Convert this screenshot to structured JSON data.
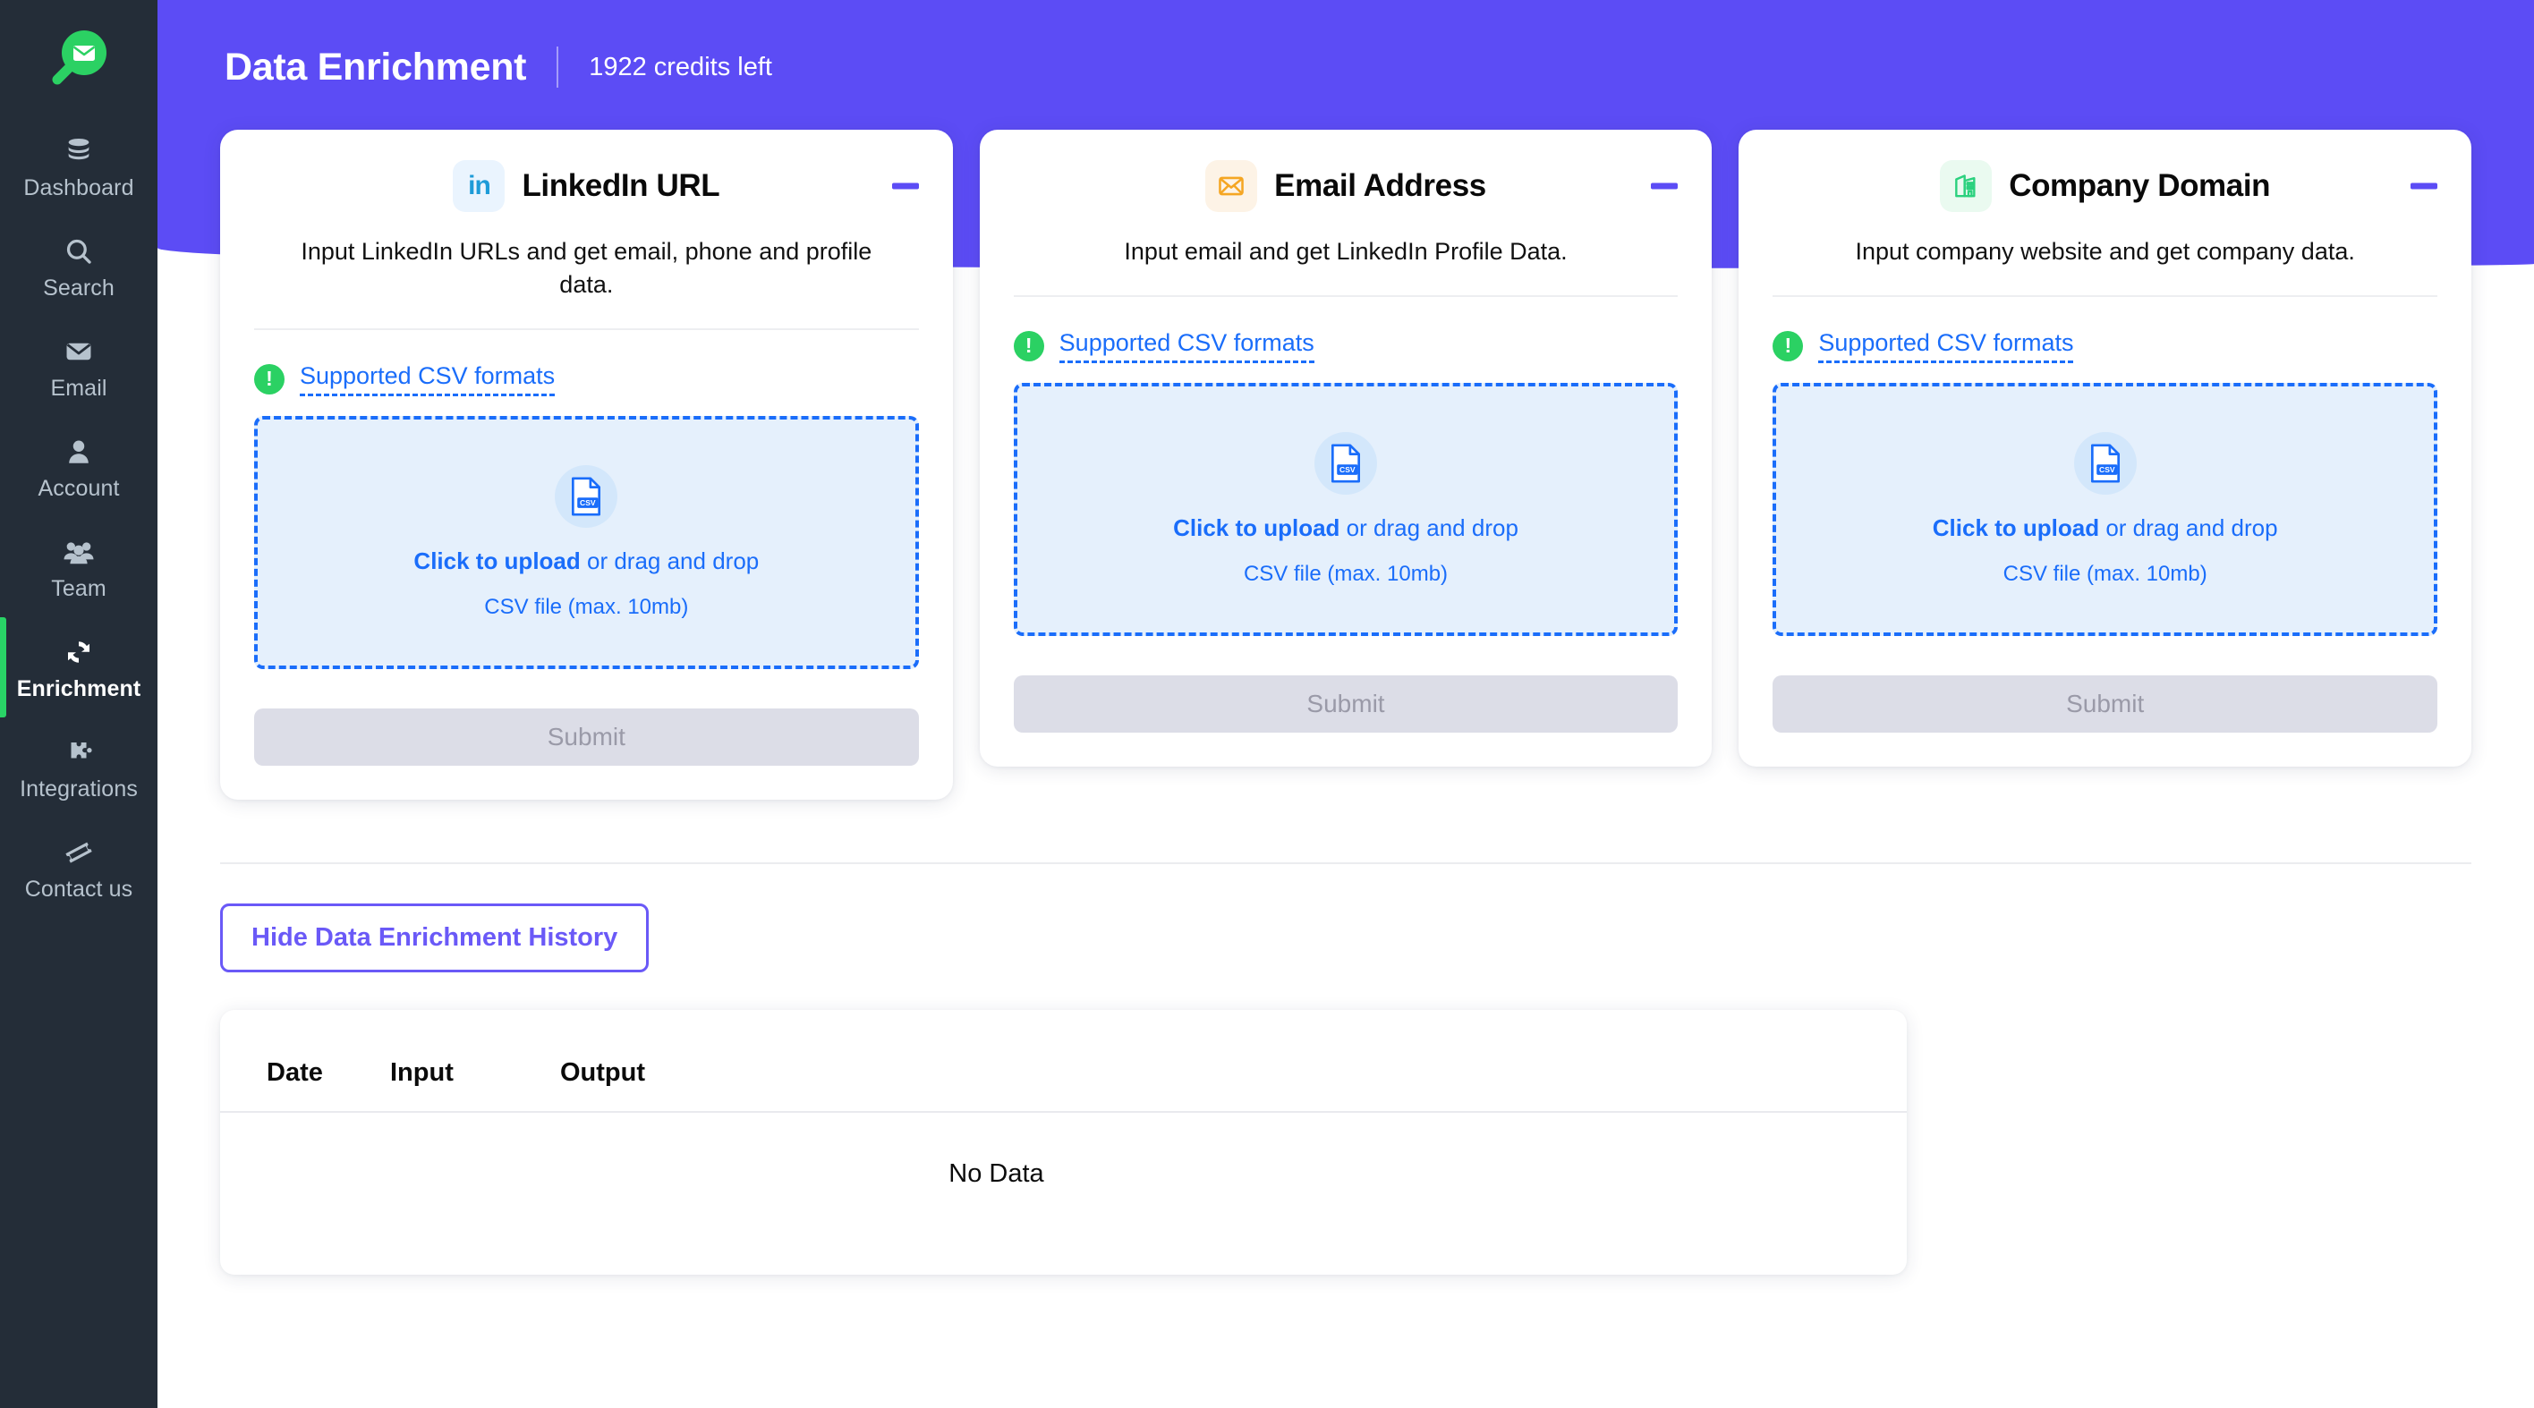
{
  "brand": {
    "logo_icon": "mail-search-logo-icon",
    "accent_purple": "#5c4cf5",
    "accent_green": "#29d366"
  },
  "sidebar": {
    "items": [
      {
        "label": "Dashboard",
        "icon": "database-icon",
        "active": false
      },
      {
        "label": "Search",
        "icon": "search-icon",
        "active": false
      },
      {
        "label": "Email",
        "icon": "envelope-icon",
        "active": false
      },
      {
        "label": "Account",
        "icon": "user-icon",
        "active": false
      },
      {
        "label": "Team",
        "icon": "users-icon",
        "active": false
      },
      {
        "label": "Enrichment",
        "icon": "refresh-icon",
        "active": true
      },
      {
        "label": "Integrations",
        "icon": "puzzle-icon",
        "active": false
      },
      {
        "label": "Contact us",
        "icon": "ticket-icon",
        "active": false
      }
    ]
  },
  "header": {
    "title": "Data Enrichment",
    "credits": "1922 credits left"
  },
  "cards": [
    {
      "icon_name": "linkedin-icon",
      "icon_glyph": "in",
      "title": "LinkedIn URL",
      "description": "Input LinkedIn URLs and get email, phone and profile data.",
      "csv_link": "Supported CSV formats",
      "dropzone": {
        "icon_name": "csv-file-icon",
        "icon_label": "CSV",
        "main_bold": "Click to upload",
        "main_rest": " or drag and drop",
        "sub": "CSV file (max. 10mb)"
      },
      "submit_label": "Submit",
      "minus_label": "collapse"
    },
    {
      "icon_name": "envelope-icon",
      "icon_glyph": "",
      "title": "Email Address",
      "description": "Input email and get LinkedIn Profile Data.",
      "csv_link": "Supported CSV formats",
      "dropzone": {
        "icon_name": "csv-file-icon",
        "icon_label": "CSV",
        "main_bold": "Click to upload",
        "main_rest": " or drag and drop",
        "sub": "CSV file (max. 10mb)"
      },
      "submit_label": "Submit",
      "minus_label": "collapse"
    },
    {
      "icon_name": "building-icon",
      "icon_glyph": "",
      "title": "Company Domain",
      "description": "Input company website and get company data.",
      "csv_link": "Supported CSV formats",
      "dropzone": {
        "icon_name": "csv-file-icon",
        "icon_label": "CSV",
        "main_bold": "Click to upload",
        "main_rest": " or drag and drop",
        "sub": "CSV file (max. 10mb)"
      },
      "submit_label": "Submit",
      "minus_label": "collapse"
    }
  ],
  "history": {
    "toggle_label": "Hide Data Enrichment History",
    "columns": [
      "Date",
      "Input",
      "Output"
    ],
    "rows": [],
    "empty_text": "No Data"
  }
}
